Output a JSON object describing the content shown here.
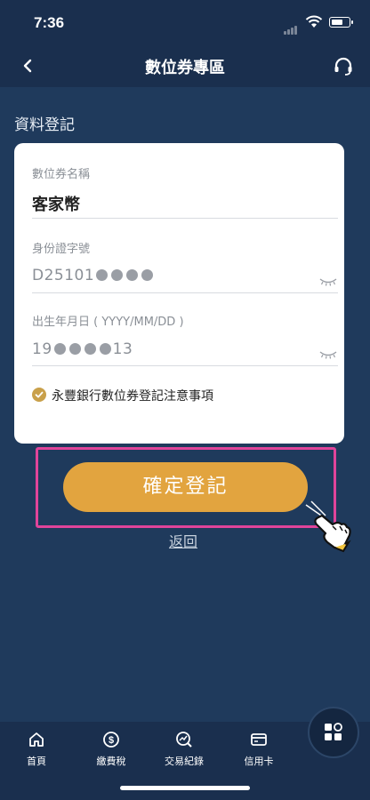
{
  "status_bar": {
    "time": "7:36"
  },
  "header": {
    "title": "數位券專區",
    "back_icon": "chevron-left-icon",
    "support_icon": "headset-icon"
  },
  "section": {
    "title": "資料登記"
  },
  "form": {
    "coupon_name": {
      "label": "數位券名稱",
      "value": "客家幣"
    },
    "id_number": {
      "label": "身份證字號",
      "value_prefix": "D25101",
      "masked_count": 4
    },
    "birthday": {
      "label": "出生年月日 ( YYYY/MM/DD )",
      "value_prefix": "19",
      "masked_count": 4,
      "value_suffix": "13"
    },
    "notice": {
      "checked": true,
      "label": "永豐銀行數位券登記注意事項"
    }
  },
  "actions": {
    "confirm_label": "確定登記",
    "return_label": "返回"
  },
  "bottom_nav": {
    "items": [
      {
        "label": "首頁",
        "icon": "home-icon"
      },
      {
        "label": "繳費稅",
        "icon": "dollar-icon"
      },
      {
        "label": "交易紀錄",
        "icon": "chart-icon"
      },
      {
        "label": "信用卡",
        "icon": "credit-card-icon"
      }
    ],
    "menu_icon": "grid-menu-icon"
  },
  "colors": {
    "background": "#1f3a5c",
    "header": "#1a2f4e",
    "accent": "#e2a43f",
    "highlight": "#e0449a"
  }
}
